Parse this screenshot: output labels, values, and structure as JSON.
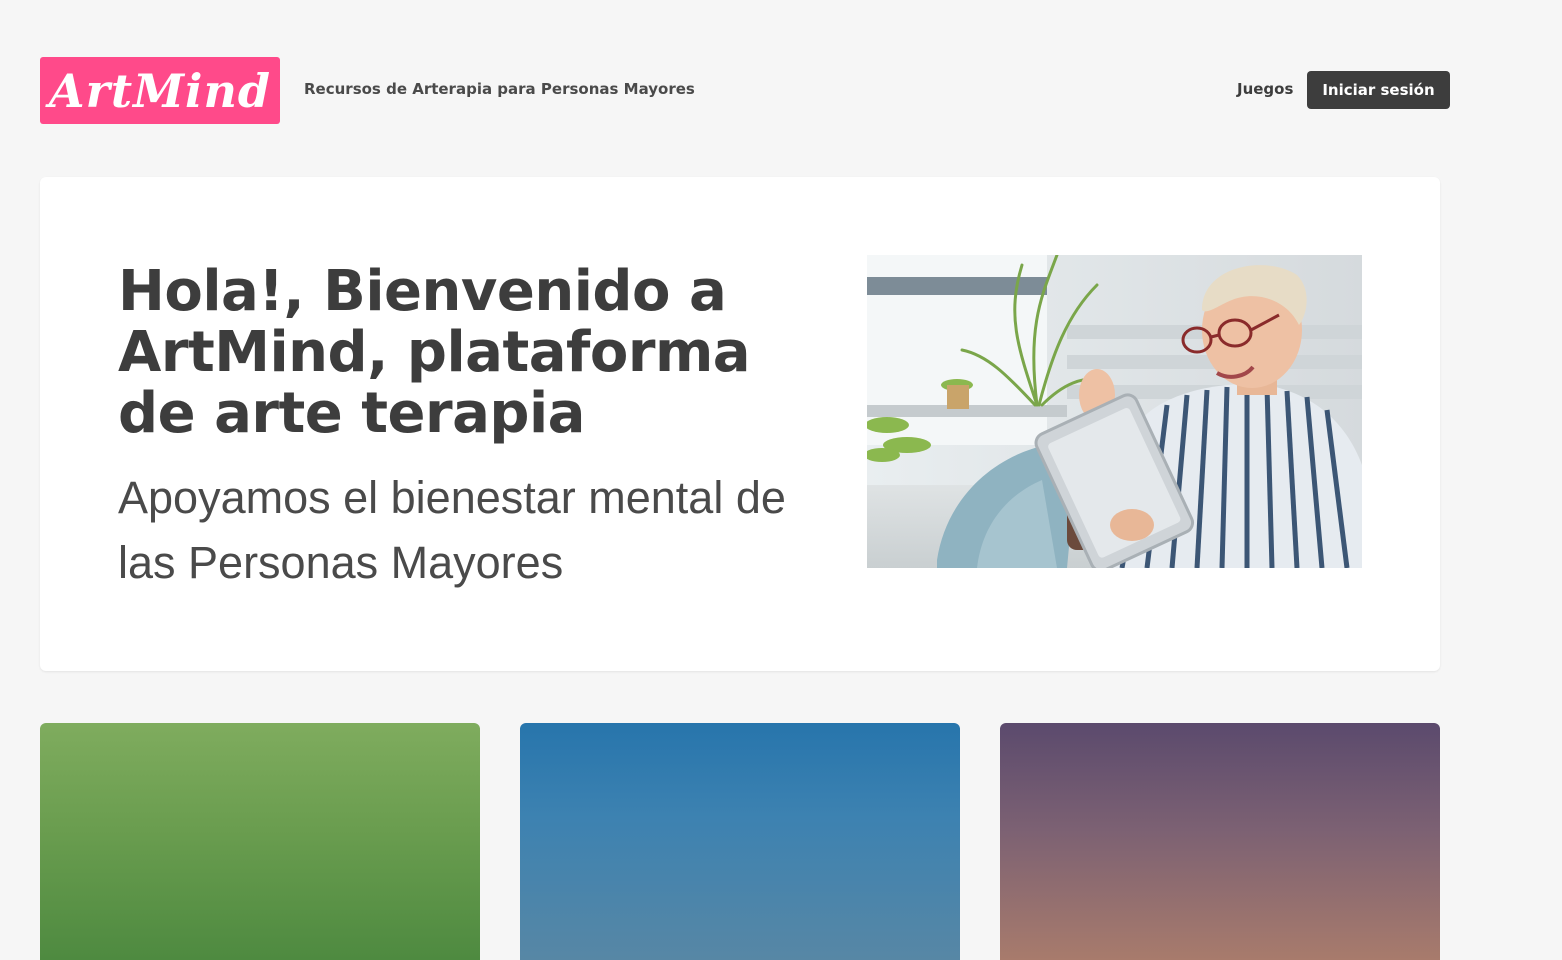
{
  "header": {
    "logo_text": "ArtMind",
    "tagline": "Recursos de Arterapia para Personas Mayores",
    "nav": {
      "games_label": "Juegos",
      "login_label": "Iniciar sesión"
    }
  },
  "hero": {
    "title": "Hola!, Bienvenido a ArtMind, plataforma de arte terapia",
    "subtitle": "Apoyamos el bienestar mental de las Personas Mayores"
  },
  "colors": {
    "brand": "#ff4a8a",
    "dark": "#3d3d3d",
    "background": "#f6f6f6"
  }
}
